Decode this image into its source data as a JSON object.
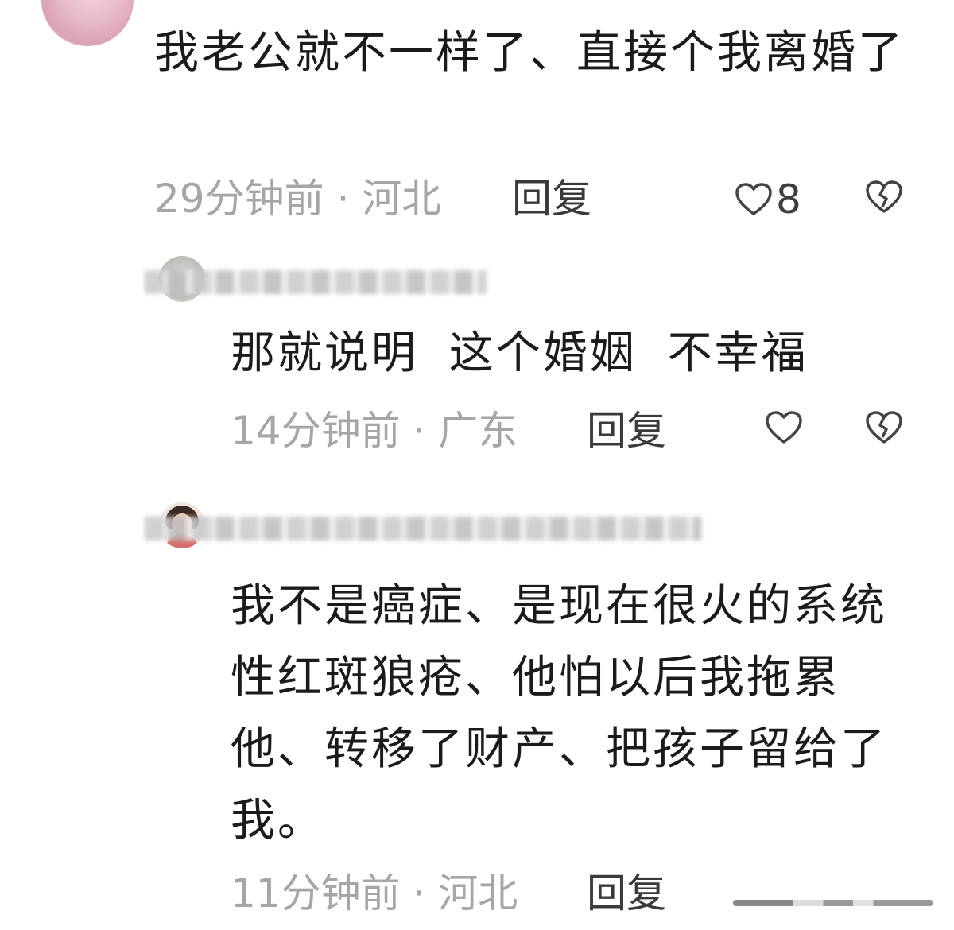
{
  "comments": [
    {
      "text": "我老公就不一样了、直接个我离婚了",
      "time": "29分钟前 · 河北",
      "reply_label": "回复",
      "likes": "8"
    },
    {
      "text": "那就说明 这个婚姻 不幸福",
      "time": "14分钟前 · 广东",
      "reply_label": "回复",
      "likes": ""
    },
    {
      "text": "我不是癌症、是现在很火的系统性红斑狼疮、他怕以后我拖累他、转移了财产、把孩子留给了我。",
      "time": "11分钟前 · 河北",
      "reply_label": "回复",
      "likes": ""
    }
  ],
  "icons": {
    "like": "heart-outline-icon",
    "dislike": "broken-heart-icon"
  },
  "colors": {
    "text": "#1b1b1b",
    "meta": "#a6a6a6",
    "reply": "#3a3a3a",
    "icon": "#444444"
  }
}
